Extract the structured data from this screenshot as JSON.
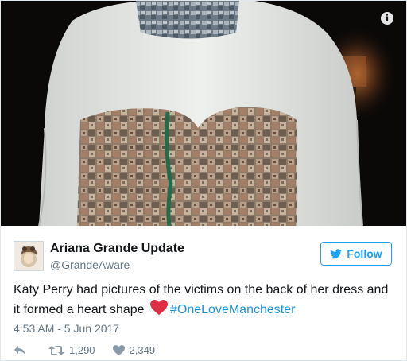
{
  "media": {
    "info_icon": "i"
  },
  "author": {
    "display_name": "Ariana Grande Update",
    "handle": "@GrandeAware"
  },
  "follow_button": {
    "label": "Follow",
    "icon": "twitter-bird-icon"
  },
  "tweet": {
    "text_before": "Katy Perry had pictures of the victims on the back of her dress and it formed a heart shape",
    "emoji": "red-heart-emoji",
    "hashtag": "#OneLoveManchester",
    "timestamp": "4:53 AM - 5 Jun 2017"
  },
  "actions": {
    "reply_icon": "reply-icon",
    "retweet_icon": "retweet-icon",
    "retweets": "1,290",
    "like_icon": "heart-icon",
    "likes": "2,349"
  },
  "colors": {
    "link": "#1b95e0",
    "follow": "#1da1f2",
    "heart": "#e0245e",
    "meta": "#657786"
  }
}
